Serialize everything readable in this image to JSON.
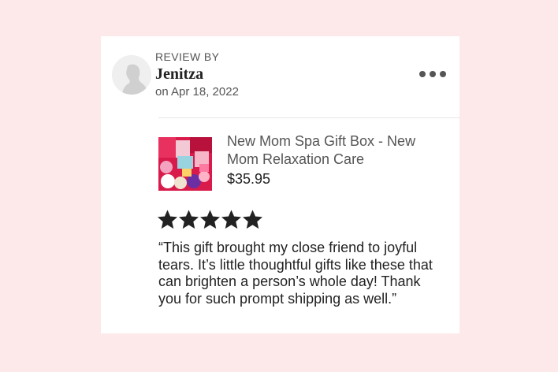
{
  "review": {
    "label": "REVIEW BY",
    "reviewer": "Jenitza",
    "date": "on Apr 18, 2022",
    "rating": 5,
    "rating_max": 5,
    "text": "“This gift brought my close friend to joyful tears. It’s little thoughtful gifts like these that can brighten a person’s whole day! Thank you for such prompt shipping as well.”"
  },
  "product": {
    "title": "New Mom Spa Gift Box - New Mom Relaxation Care",
    "price": "$35.95"
  },
  "icons": {
    "avatar": "user-silhouette-icon",
    "more": "more-horizontal-icon",
    "star": "star-icon"
  },
  "colors": {
    "page_background": "#fde9ea",
    "card_background": "#ffffff",
    "star": "#222222"
  }
}
